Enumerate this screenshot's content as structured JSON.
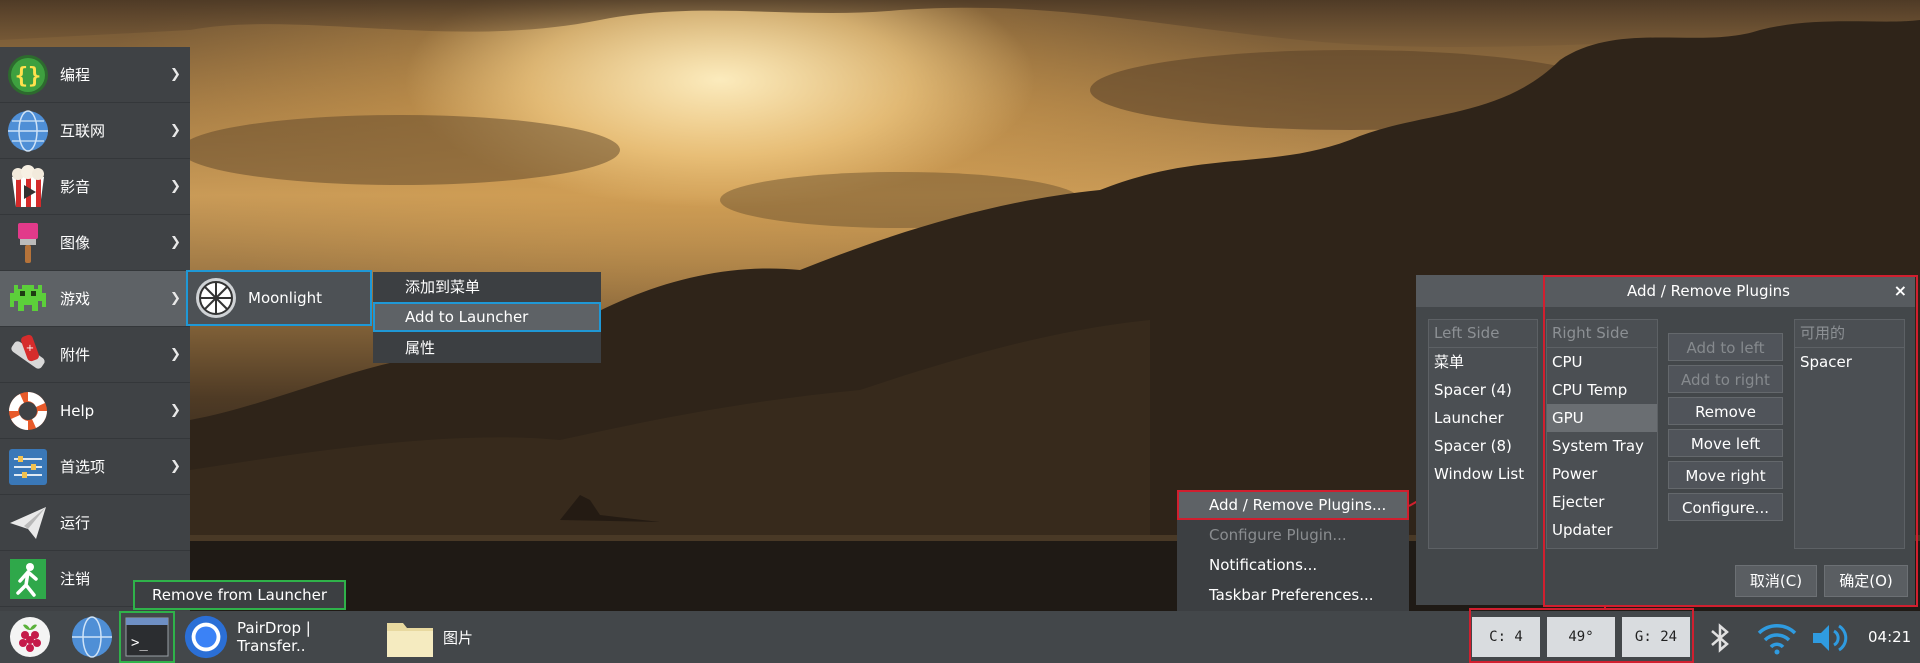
{
  "main_menu": {
    "items": [
      {
        "label": "编程",
        "icon": "programming-icon"
      },
      {
        "label": "互联网",
        "icon": "internet-globe-icon"
      },
      {
        "label": "影音",
        "icon": "sound-video-icon"
      },
      {
        "label": "图像",
        "icon": "graphics-icon"
      },
      {
        "label": "游戏",
        "icon": "games-icon"
      },
      {
        "label": "附件",
        "icon": "accessories-icon"
      },
      {
        "label": "Help",
        "icon": "help-lifebuoy-icon"
      },
      {
        "label": "首选项",
        "icon": "preferences-icon"
      },
      {
        "label": "运行",
        "icon": "run-icon"
      },
      {
        "label": "注销",
        "icon": "logout-icon"
      }
    ]
  },
  "games_submenu": {
    "item_label": "Moonlight"
  },
  "context_menu": {
    "items": [
      "添加到菜单",
      "Add to Launcher",
      "属性"
    ]
  },
  "launcher_context": {
    "label": "Remove from Launcher"
  },
  "panel_menu": {
    "items": [
      "Add / Remove Plugins...",
      "Configure Plugin...",
      "Notifications...",
      "Taskbar Preferences..."
    ]
  },
  "plugins_dialog": {
    "title": "Add / Remove Plugins",
    "close": "×",
    "left_side": {
      "header": "Left Side",
      "items": [
        "菜单",
        "Spacer (4)",
        "Launcher",
        "Spacer (8)",
        "Window List"
      ]
    },
    "right_side": {
      "header": "Right Side",
      "items": [
        "CPU",
        "CPU Temp",
        "GPU",
        "System Tray",
        "Power",
        "Ejecter",
        "Updater"
      ]
    },
    "available": {
      "header": "可用的",
      "items": [
        "Spacer"
      ]
    },
    "buttons": [
      "Add to left",
      "Add to right",
      "Remove",
      "Move left",
      "Move right",
      "Configure..."
    ],
    "cancel": "取消(C)",
    "ok": "确定(O)"
  },
  "taskbar": {
    "tasks": [
      {
        "label": "PairDrop | Transfer..",
        "icon": "chromium-icon"
      },
      {
        "label": "图片",
        "icon": "folder-icon"
      }
    ],
    "monitors": {
      "cpu": "C:  4",
      "temp": "49°",
      "gpu": "G: 24"
    },
    "clock": "04:21"
  },
  "colors": {
    "panel": "#43474a",
    "highlight_blue": "#1f98d6",
    "highlight_red": "#d11f2f",
    "highlight_green": "#2fb24a"
  }
}
